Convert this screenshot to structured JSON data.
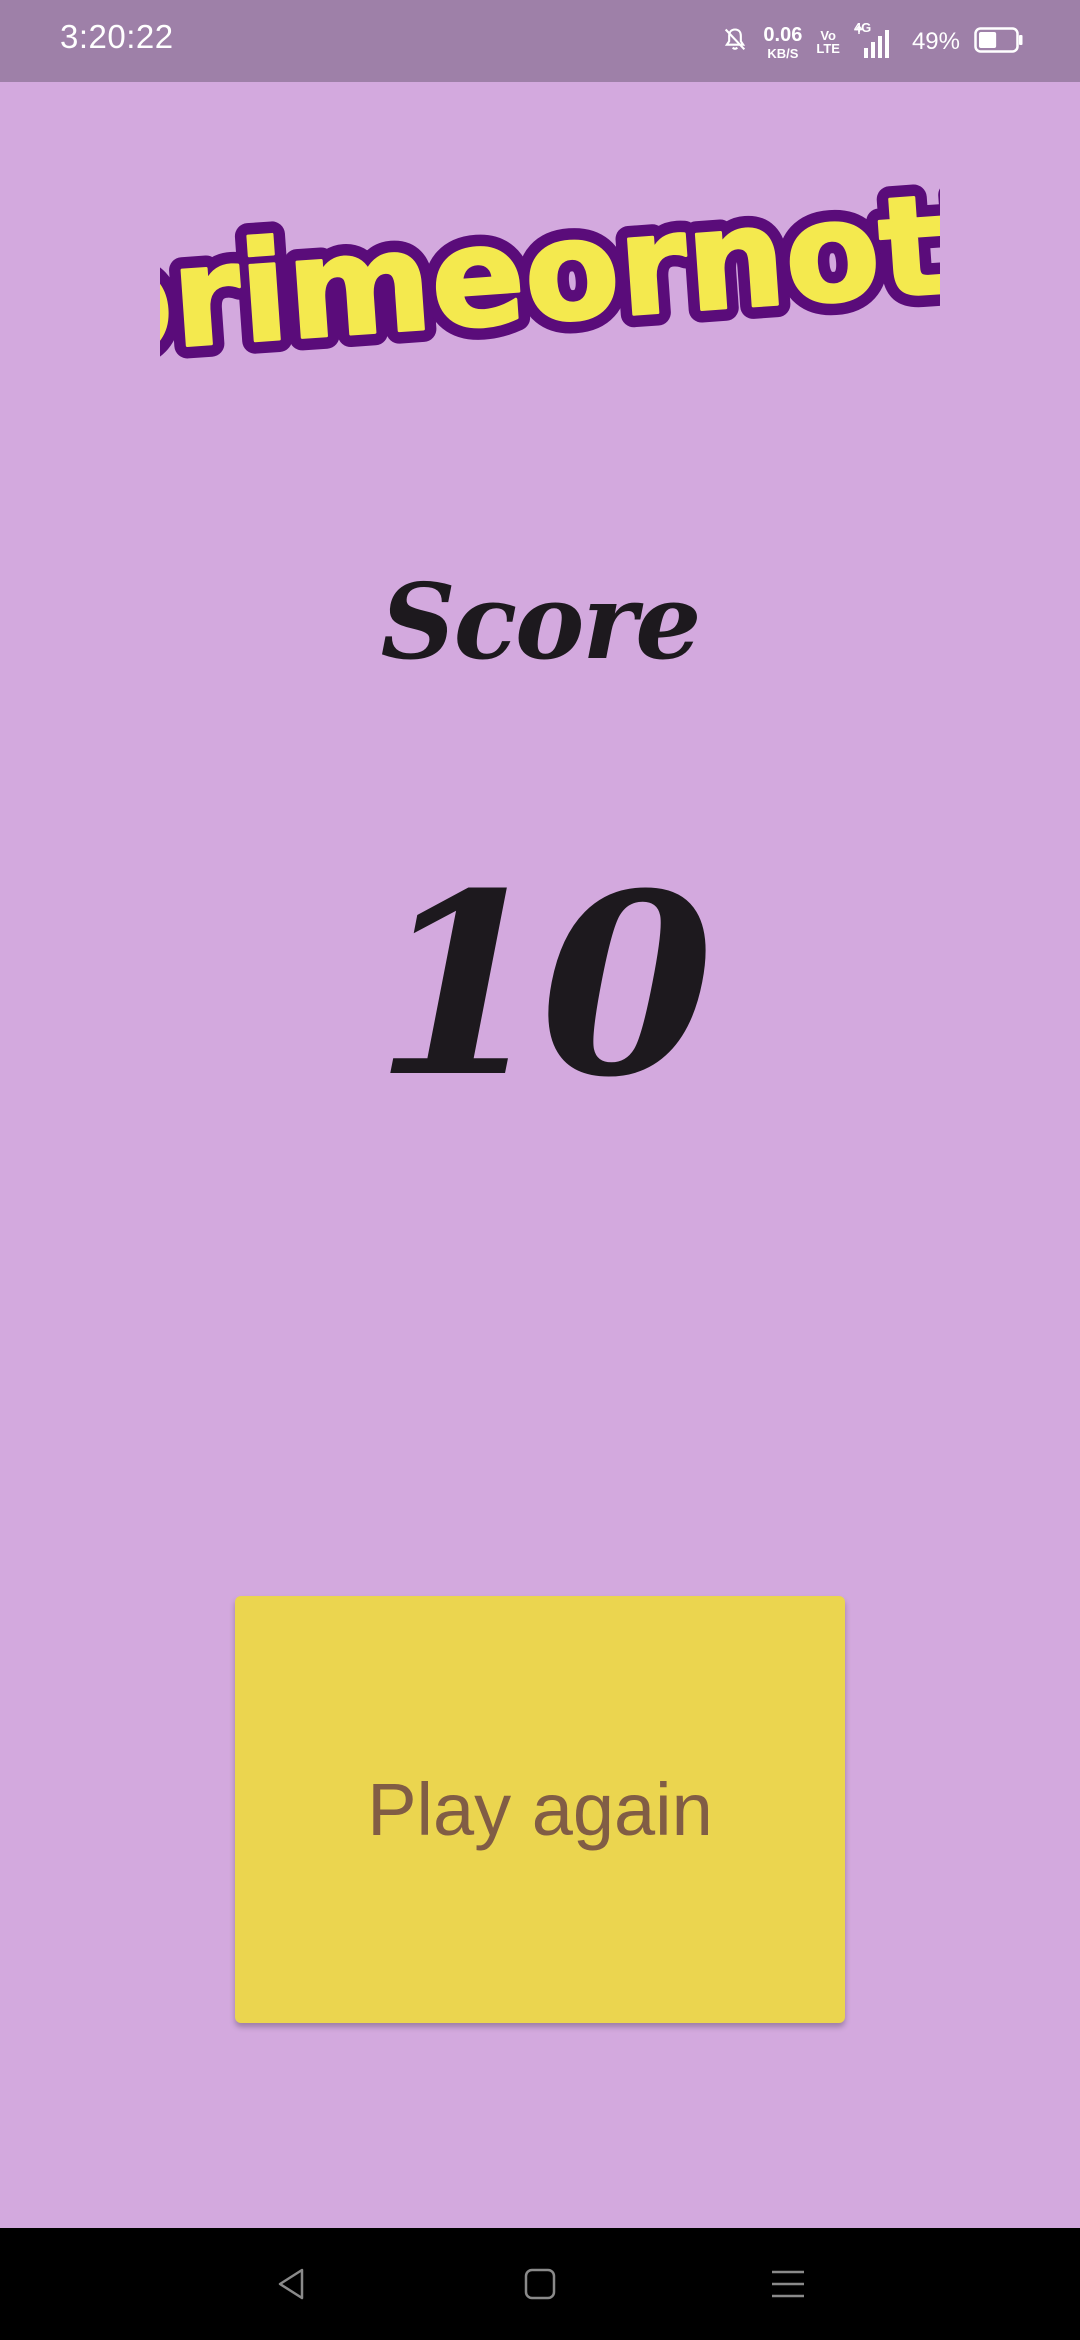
{
  "status_bar": {
    "time": "3:20:22",
    "net_speed_value": "0.06",
    "net_speed_unit": "KB/S",
    "volte_top": "Vo",
    "volte_bottom": "LTE",
    "network_type": "4G",
    "battery_percent": "49%",
    "battery_level": 0.49,
    "icons": [
      "mute-bell-icon",
      "signal-icon",
      "battery-icon"
    ]
  },
  "logo": {
    "text": "primeornot?"
  },
  "score": {
    "label": "Score",
    "value": "10"
  },
  "play_again_button": {
    "label": "Play again"
  },
  "nav_bar": {
    "icons": [
      "back-icon",
      "home-icon",
      "recents-icon"
    ]
  },
  "colors": {
    "background": "#d3a9de",
    "status_bar": "#9e80a8",
    "button": "#ebd54f",
    "button_text": "#815d45",
    "score_text": "#1d191e",
    "logo_fill": "#f4e94e",
    "logo_outline": "#5a0c7a"
  }
}
